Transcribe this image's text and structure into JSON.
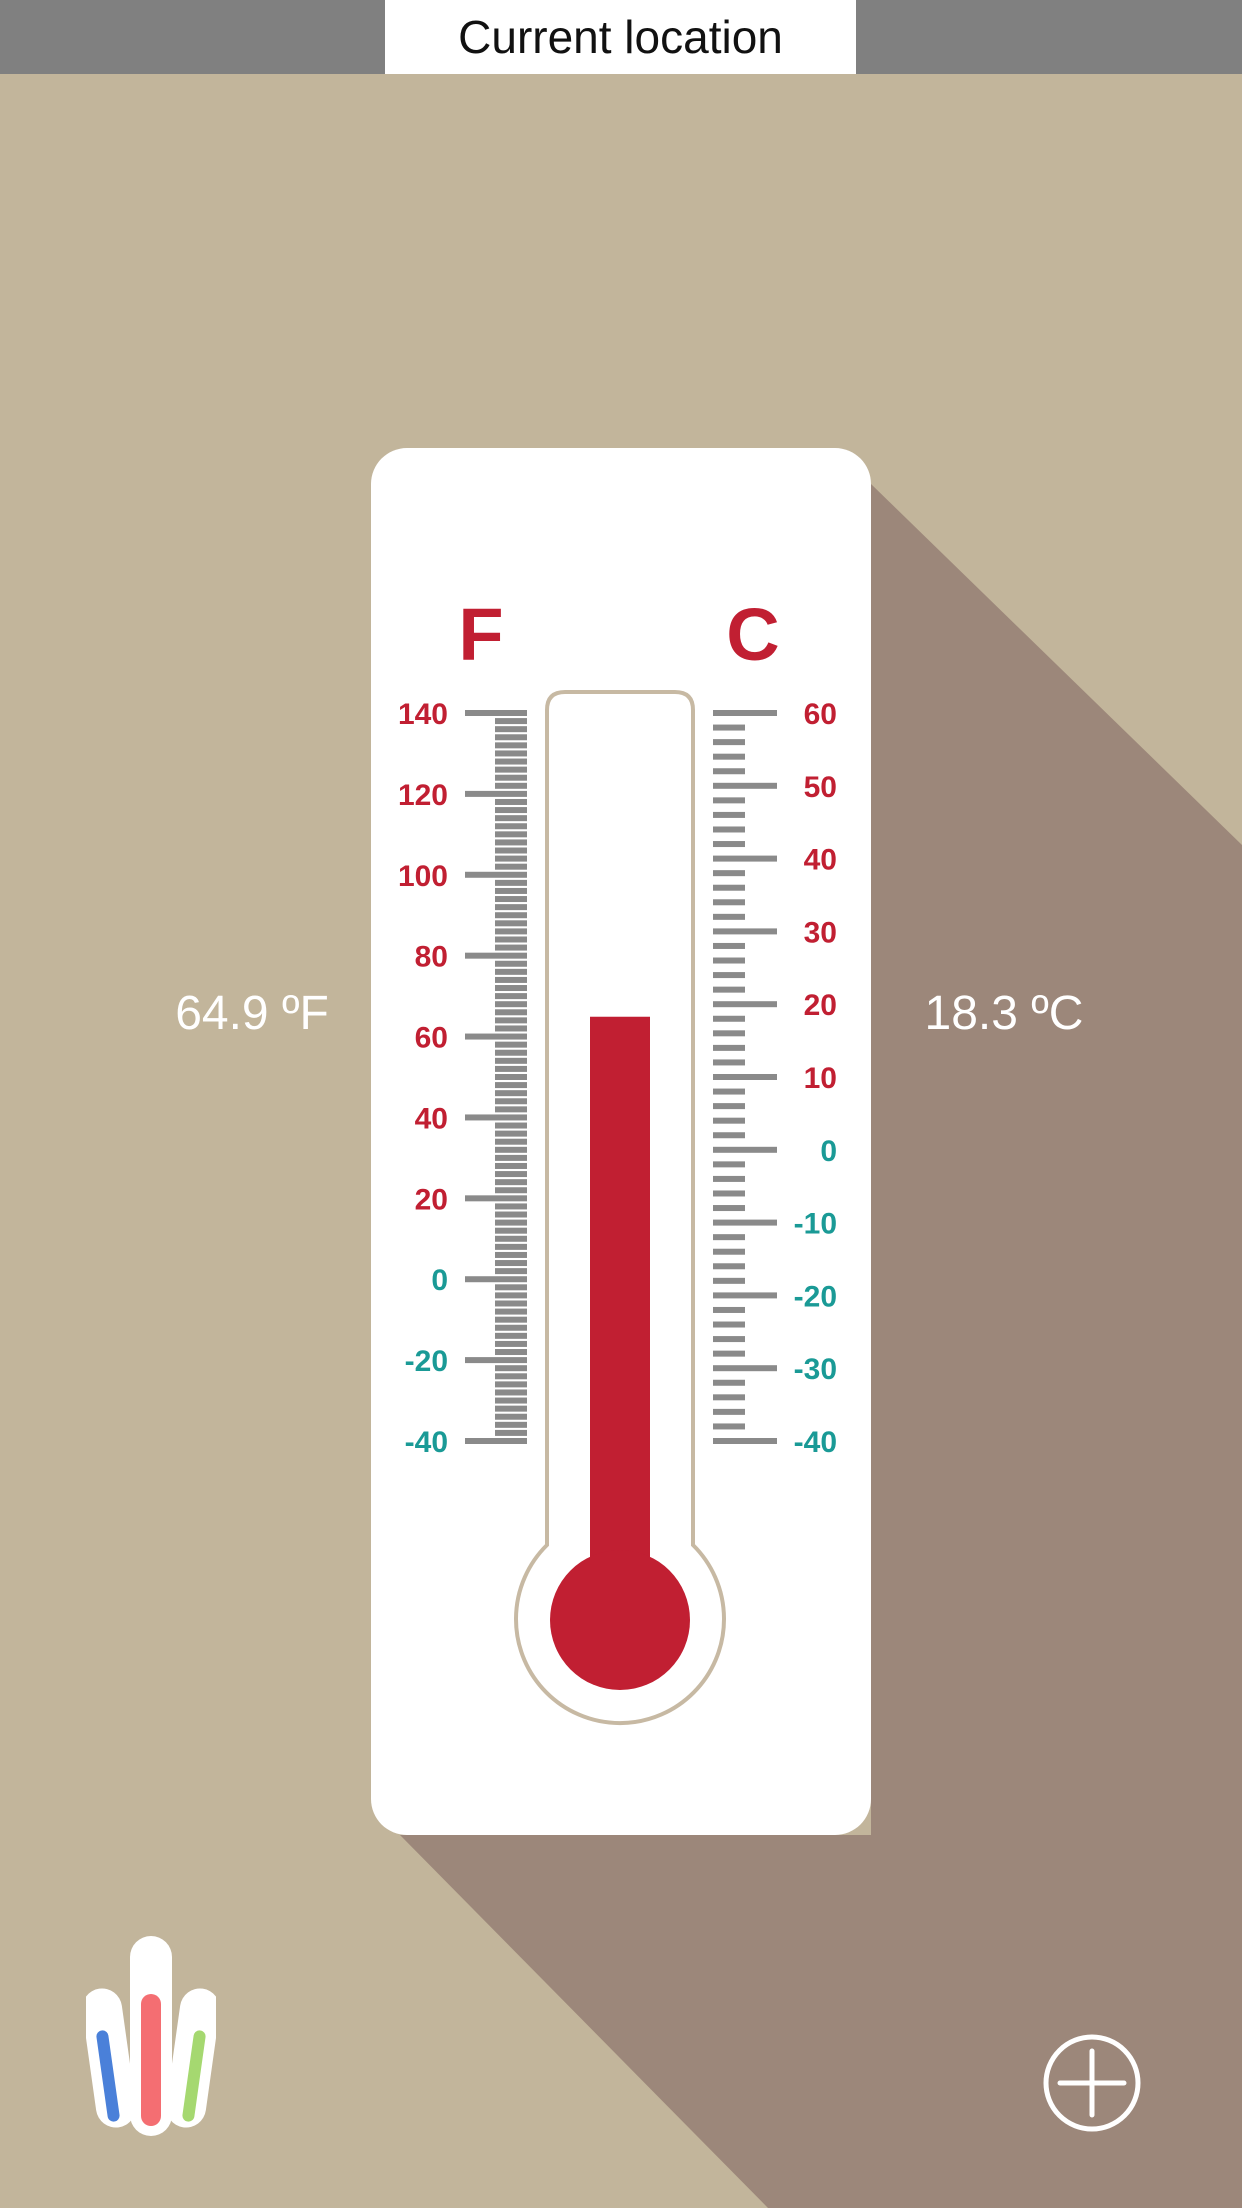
{
  "header": {
    "location_label": "Current location"
  },
  "readings": {
    "fahrenheit": "64.9 ºF",
    "celsius": "18.3 ºC"
  },
  "thermometer": {
    "fahrenheit_unit": "F",
    "celsius_unit": "C",
    "fahrenheit_ticks": [
      "140",
      "120",
      "100",
      "80",
      "60",
      "40",
      "20",
      "0",
      "-20",
      "-40"
    ],
    "celsius_ticks": [
      "60",
      "50",
      "40",
      "30",
      "20",
      "10",
      "0",
      "-10",
      "-20",
      "-30",
      "-40"
    ],
    "current_fahrenheit": 64.9,
    "current_celsius": 18.3
  },
  "colors": {
    "background": "#c2b59b",
    "shadow": "#9c877a",
    "top_bar": "#808080",
    "mercury_red": "#c11f32",
    "positive_label": "#c11f32",
    "negative_label": "#1a9a96",
    "tick_gray": "#8a8a8a",
    "tube_border": "#c7b9a3"
  },
  "icons": {
    "logo": "thermometers-logo-icon",
    "add": "plus-circle-icon"
  }
}
